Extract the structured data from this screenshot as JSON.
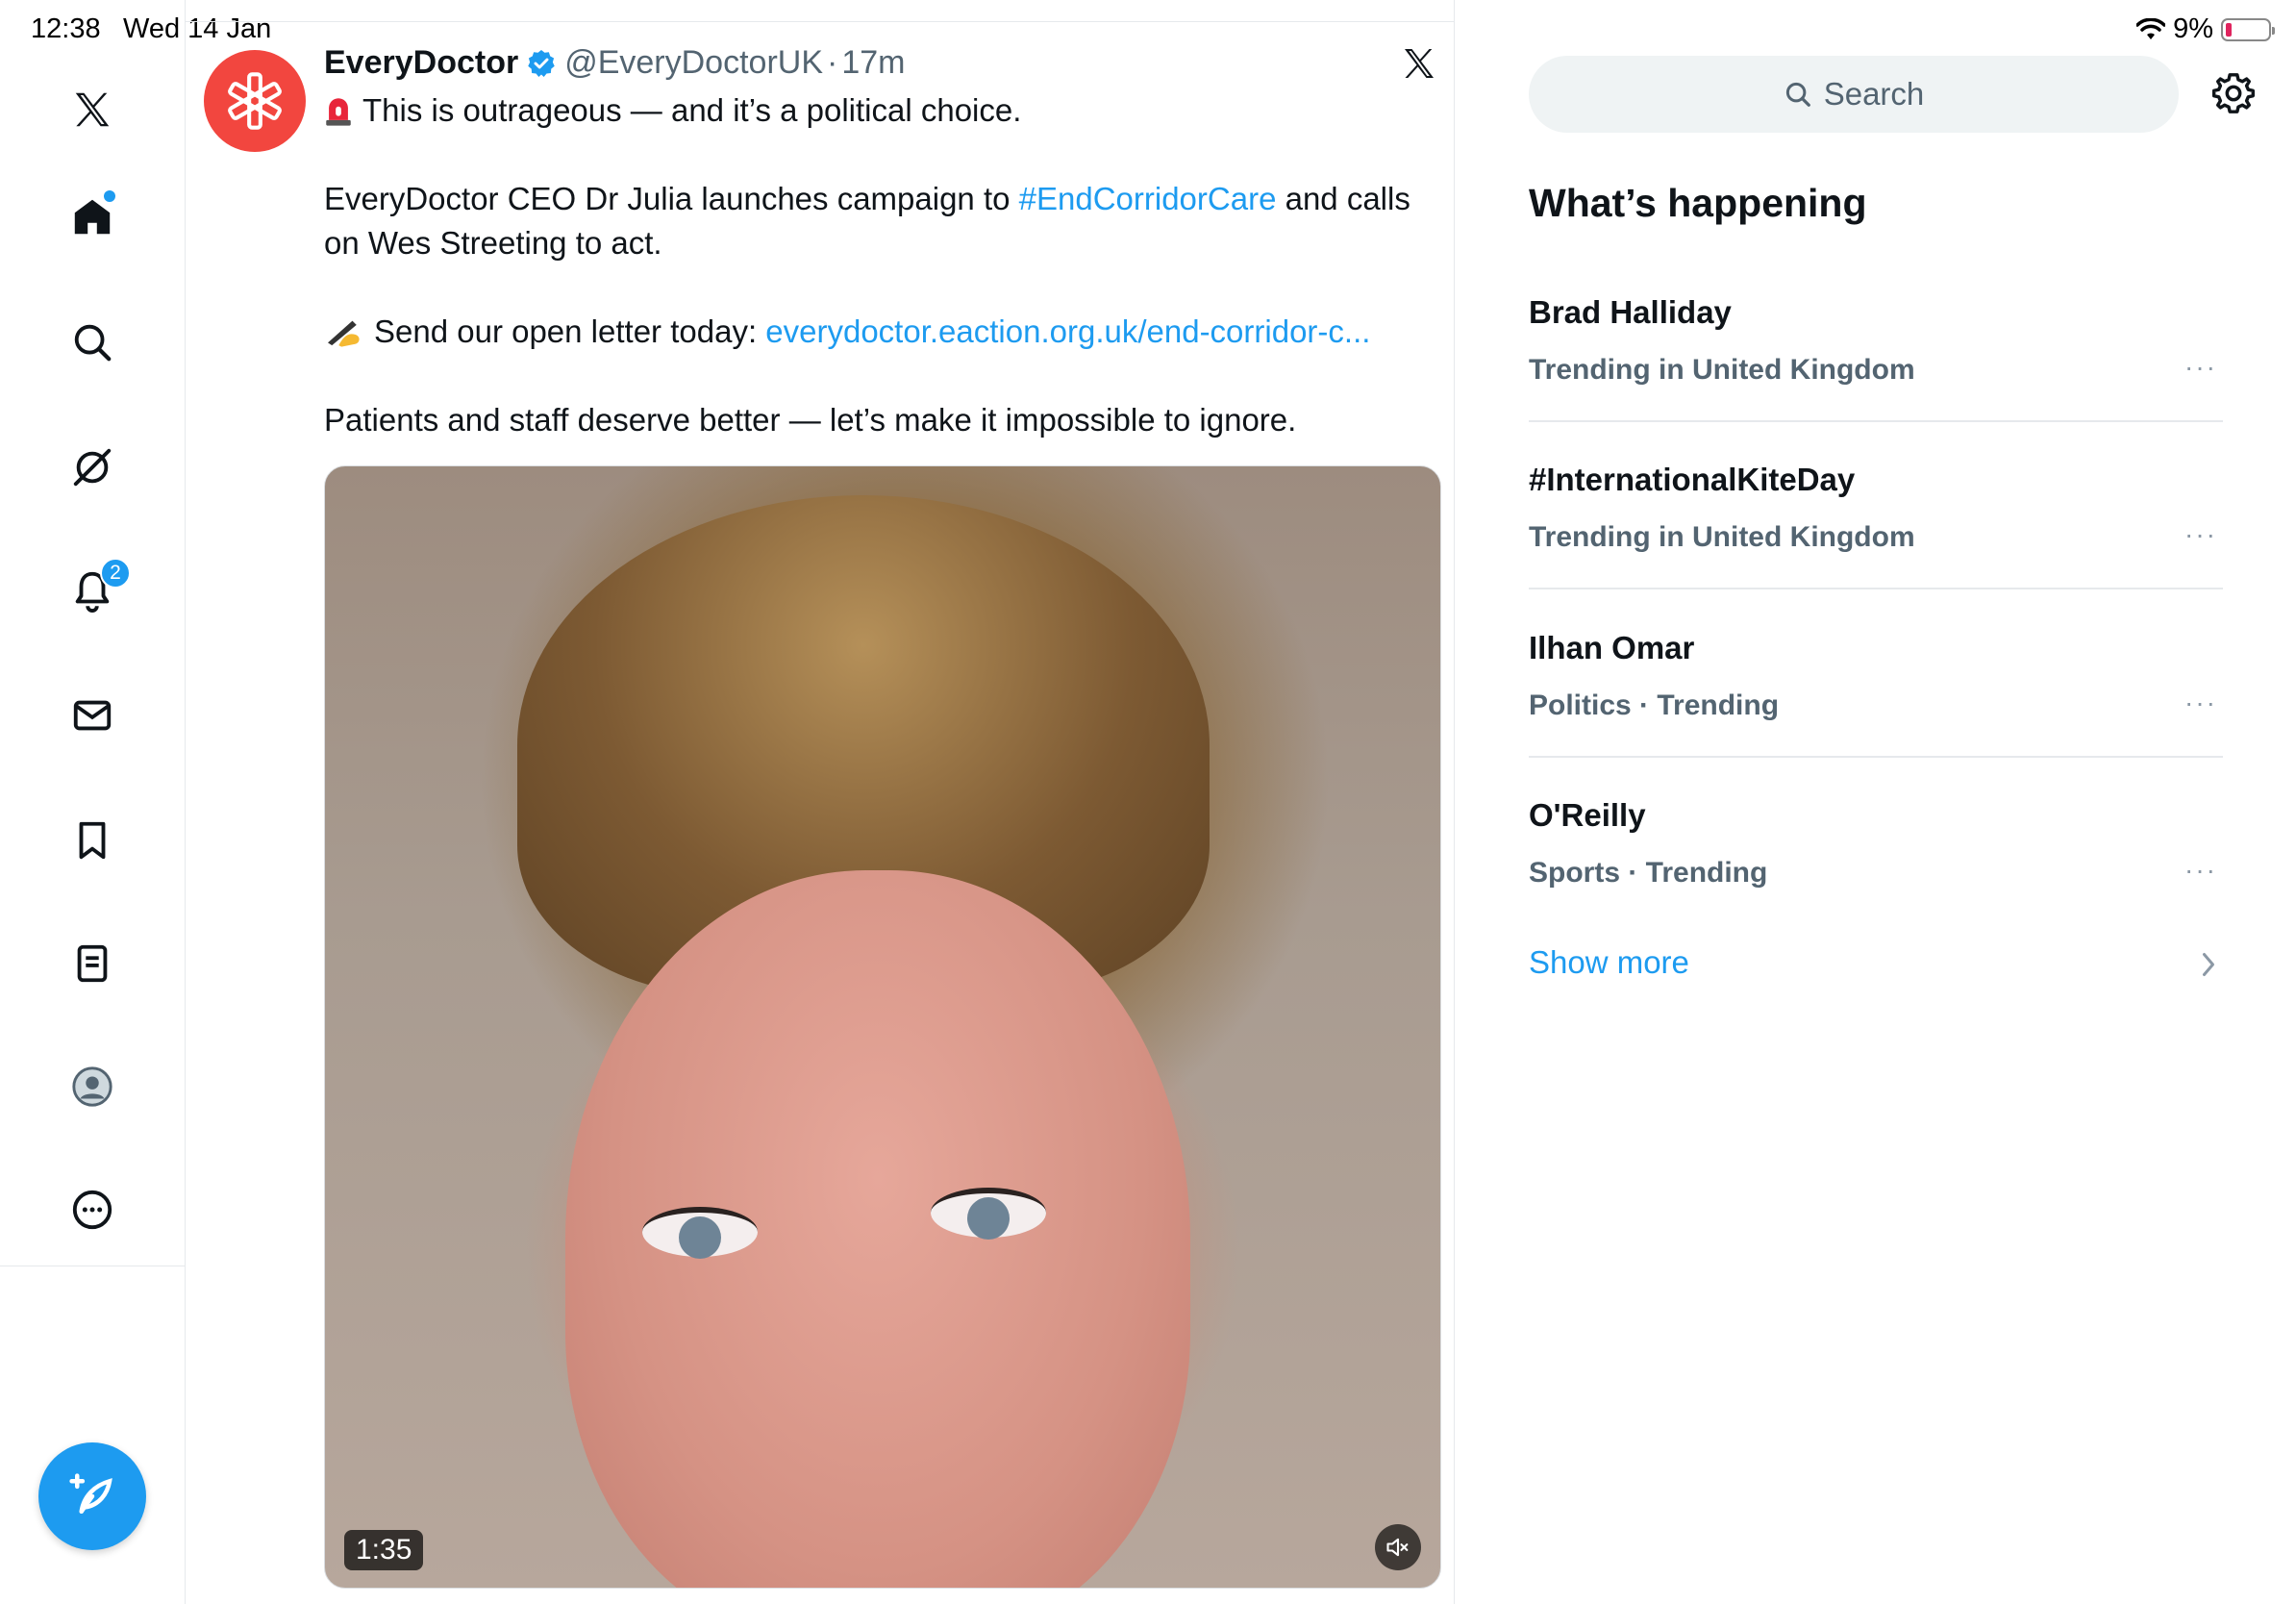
{
  "status_bar": {
    "time": "12:38",
    "date": "Wed 14 Jan",
    "battery": "9%"
  },
  "nav": {
    "notifications_badge": "2"
  },
  "tweet": {
    "name": "EveryDoctor",
    "handle": "@EveryDoctorUK",
    "separator": "·",
    "time": "17m",
    "line1": "This is outrageous — and it’s a political choice.",
    "line2_prefix": "EveryDoctor CEO Dr Julia launches campaign to ",
    "line2_hashtag": "#EndCorridorCare",
    "line2_suffix": " and calls on Wes Streeting to act.",
    "line3_prefix": "Send our open letter today: ",
    "line3_link": "everydoctor.eaction.org.uk/end-corridor-c...",
    "line4": "Patients and staff deserve better — let’s make it impossible to ignore.",
    "video_duration": "1:35"
  },
  "right": {
    "search_placeholder": "Search",
    "section_title": "What’s happening",
    "trends": [
      {
        "name": "Brad Halliday",
        "meta": "Trending in United Kingdom"
      },
      {
        "name": "#InternationalKiteDay",
        "meta": "Trending in United Kingdom"
      },
      {
        "name": "Ilhan Omar",
        "meta": "Politics · Trending"
      },
      {
        "name": "O'Reilly",
        "meta": "Sports · Trending"
      }
    ],
    "more_glyph": "···",
    "show_more": "Show more"
  },
  "colors": {
    "accent": "#1d9bf0",
    "avatar": "#f2463f",
    "text": "#0f1419",
    "muted": "#536471"
  },
  "icons": [
    "x-logo-icon",
    "home-icon",
    "search-icon",
    "grok-icon",
    "bell-icon",
    "mail-icon",
    "bookmark-icon",
    "lists-icon",
    "profile-icon",
    "more-icon",
    "compose-icon",
    "verified-icon",
    "mute-icon",
    "settings-icon",
    "wifi-icon",
    "battery-icon",
    "chevron-right-icon"
  ]
}
